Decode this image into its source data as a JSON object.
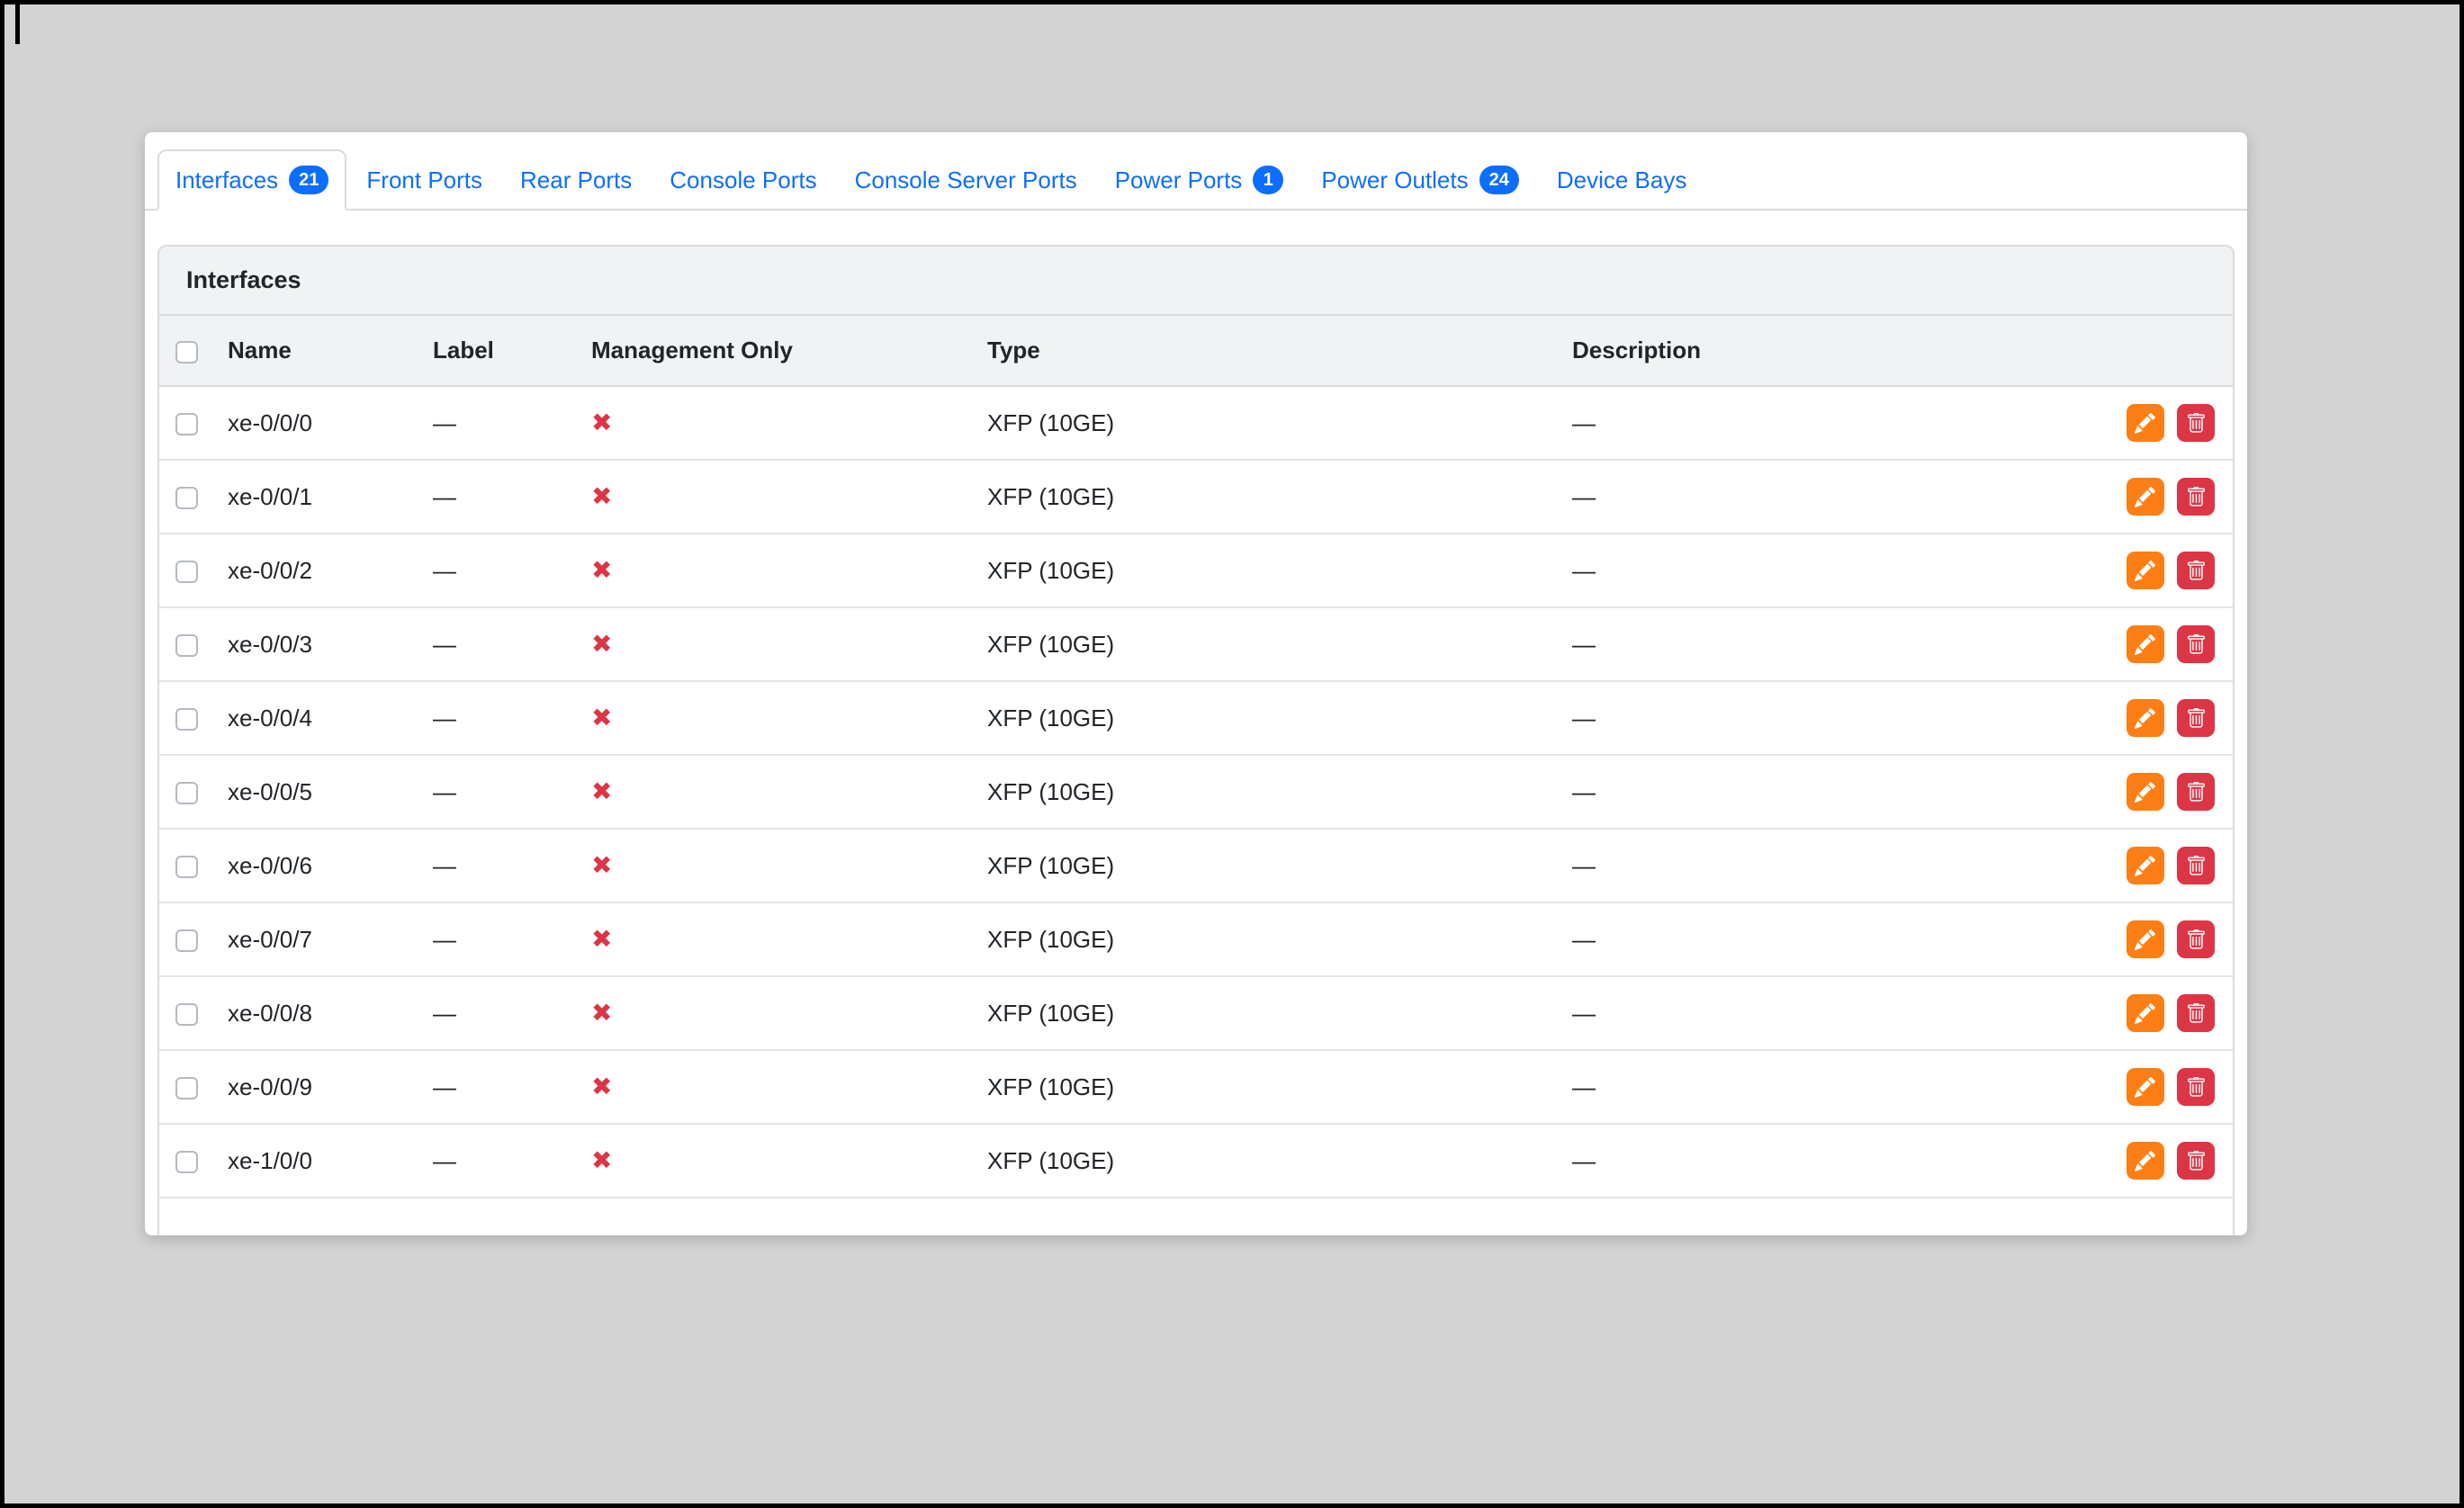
{
  "tabs": [
    {
      "label": "Interfaces",
      "badge": "21",
      "active": true
    },
    {
      "label": "Front Ports",
      "badge": null,
      "active": false
    },
    {
      "label": "Rear Ports",
      "badge": null,
      "active": false
    },
    {
      "label": "Console Ports",
      "badge": null,
      "active": false
    },
    {
      "label": "Console Server Ports",
      "badge": null,
      "active": false
    },
    {
      "label": "Power Ports",
      "badge": "1",
      "active": false
    },
    {
      "label": "Power Outlets",
      "badge": "24",
      "active": false
    },
    {
      "label": "Device Bays",
      "badge": null,
      "active": false
    }
  ],
  "panel": {
    "title": "Interfaces",
    "columns": {
      "name": "Name",
      "label": "Label",
      "management_only": "Management Only",
      "type": "Type",
      "description": "Description"
    },
    "rows": [
      {
        "name": "xe-0/0/0",
        "label": "—",
        "management_only": false,
        "type": "XFP (10GE)",
        "description": "—"
      },
      {
        "name": "xe-0/0/1",
        "label": "—",
        "management_only": false,
        "type": "XFP (10GE)",
        "description": "—"
      },
      {
        "name": "xe-0/0/2",
        "label": "—",
        "management_only": false,
        "type": "XFP (10GE)",
        "description": "—"
      },
      {
        "name": "xe-0/0/3",
        "label": "—",
        "management_only": false,
        "type": "XFP (10GE)",
        "description": "—"
      },
      {
        "name": "xe-0/0/4",
        "label": "—",
        "management_only": false,
        "type": "XFP (10GE)",
        "description": "—"
      },
      {
        "name": "xe-0/0/5",
        "label": "—",
        "management_only": false,
        "type": "XFP (10GE)",
        "description": "—"
      },
      {
        "name": "xe-0/0/6",
        "label": "—",
        "management_only": false,
        "type": "XFP (10GE)",
        "description": "—"
      },
      {
        "name": "xe-0/0/7",
        "label": "—",
        "management_only": false,
        "type": "XFP (10GE)",
        "description": "—"
      },
      {
        "name": "xe-0/0/8",
        "label": "—",
        "management_only": false,
        "type": "XFP (10GE)",
        "description": "—"
      },
      {
        "name": "xe-0/0/9",
        "label": "—",
        "management_only": false,
        "type": "XFP (10GE)",
        "description": "—"
      },
      {
        "name": "xe-1/0/0",
        "label": "—",
        "management_only": false,
        "type": "XFP (10GE)",
        "description": "—"
      }
    ]
  },
  "glyphs": {
    "management_only_false": "✖",
    "empty_value": "—"
  },
  "icons": {
    "edit": "pencil-icon",
    "delete": "trash-icon",
    "management_only_false": "red-x-icon"
  },
  "colors": {
    "accent_blue": "#0d6efd",
    "danger_red": "#dc3545",
    "edit_orange": "#fd7e14",
    "page_background": "#d3d3d3"
  }
}
